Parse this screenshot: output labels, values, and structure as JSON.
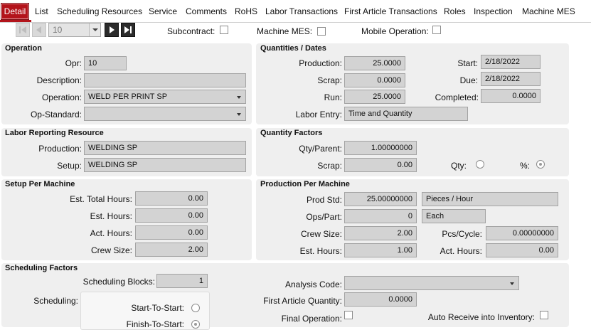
{
  "tabs": [
    "Detail",
    "List",
    "Scheduling Resources",
    "Service",
    "Comments",
    "RoHS",
    "Labor Transactions",
    "First Article Transactions",
    "Roles",
    "Inspection",
    "Machine MES"
  ],
  "toolbar": {
    "record": "10",
    "subcontract_label": "Subcontract:",
    "machine_mes_label": "Machine MES:",
    "mobile_operation_label": "Mobile Operation:"
  },
  "operation": {
    "title": "Operation",
    "opr_label": "Opr:",
    "opr": "10",
    "description_label": "Description:",
    "description": "",
    "operation_label": "Operation:",
    "operation": "WELD PER PRINT SP",
    "opstandard_label": "Op-Standard:",
    "opstandard": ""
  },
  "quantities": {
    "title": "Quantities / Dates",
    "production_label": "Production:",
    "production": "25.0000",
    "scrap_label": "Scrap:",
    "scrap": "0.0000",
    "run_label": "Run:",
    "run": "25.0000",
    "labor_entry_label": "Labor Entry:",
    "labor_entry": "Time and Quantity",
    "start_label": "Start:",
    "start": "2/18/2022",
    "due_label": "Due:",
    "due": "2/18/2022",
    "completed_label": "Completed:",
    "completed": "0.0000"
  },
  "labor_resource": {
    "title": "Labor Reporting Resource",
    "production_label": "Production:",
    "production": "WELDING SP",
    "setup_label": "Setup:",
    "setup": "WELDING SP"
  },
  "quantity_factors": {
    "title": "Quantity Factors",
    "qty_parent_label": "Qty/Parent:",
    "qty_parent": "1.00000000",
    "scrap_label": "Scrap:",
    "scrap": "0.00",
    "qty_label": "Qty:",
    "pct_label": "%:"
  },
  "setup_machine": {
    "title": "Setup Per Machine",
    "est_total_label": "Est. Total Hours:",
    "est_total": "0.00",
    "est_hours_label": "Est. Hours:",
    "est_hours": "0.00",
    "act_hours_label": "Act. Hours:",
    "act_hours": "0.00",
    "crew_label": "Crew Size:",
    "crew": "2.00"
  },
  "production_machine": {
    "title": "Production Per Machine",
    "prod_std_label": "Prod Std:",
    "prod_std": "25.00000000",
    "prod_std_unit": "Pieces / Hour",
    "ops_part_label": "Ops/Part:",
    "ops_part": "0",
    "ops_part_unit": "Each",
    "crew_label": "Crew Size:",
    "crew": "2.00",
    "pcs_cycle_label": "Pcs/Cycle:",
    "pcs_cycle": "0.00000000",
    "est_hours_label": "Est. Hours:",
    "est_hours": "1.00",
    "act_hours_label": "Act. Hours:",
    "act_hours": "0.00"
  },
  "scheduling": {
    "title": "Scheduling Factors",
    "blocks_label": "Scheduling Blocks:",
    "blocks": "1",
    "scheduling_label": "Scheduling:",
    "sts_label": "Start-To-Start:",
    "fts_label": "Finish-To-Start:",
    "analysis_label": "Analysis Code:",
    "analysis": "",
    "fa_qty_label": "First Article Quantity:",
    "fa_qty": "0.0000",
    "final_op_label": "Final Operation:",
    "auto_receive_label": "Auto Receive into Inventory:"
  }
}
